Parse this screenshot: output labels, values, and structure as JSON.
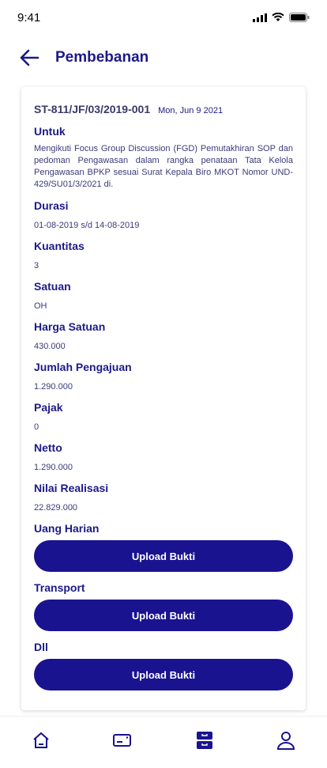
{
  "status": {
    "time": "9:41"
  },
  "header": {
    "title": "Pembebanan"
  },
  "card": {
    "code": "ST-811/JF/03/2019-001",
    "date": "Mon, Jun 9 2021",
    "untuk_label": "Untuk",
    "untuk": "Mengikuti Focus Group Discussion (FGD) Pemutakhiran SOP dan pedoman Pengawasan dalam rangka penataan Tata Kelola Pengawasan BPKP sesuai Surat Kepala Biro MKOT Nomor UND-429/SU01/3/2021 di.",
    "fields": [
      {
        "label": "Durasi",
        "value": "01-08-2019 s/d 14-08-2019"
      },
      {
        "label": "Kuantitas",
        "value": "3"
      },
      {
        "label": "Satuan",
        "value": "OH"
      },
      {
        "label": "Harga Satuan",
        "value": "430.000"
      },
      {
        "label": "Jumlah Pengajuan",
        "value": "1.290.000"
      },
      {
        "label": "Pajak",
        "value": "0"
      },
      {
        "label": "Netto",
        "value": "1.290.000"
      },
      {
        "label": "Nilai Realisasi",
        "value": "22.829.000"
      }
    ],
    "uploads": [
      {
        "label": "Uang Harian",
        "button": "Upload Bukti"
      },
      {
        "label": "Transport",
        "button": "Upload Bukti"
      },
      {
        "label": "Dll",
        "button": "Upload Bukti"
      }
    ]
  },
  "colors": {
    "primary": "#1a1390"
  }
}
